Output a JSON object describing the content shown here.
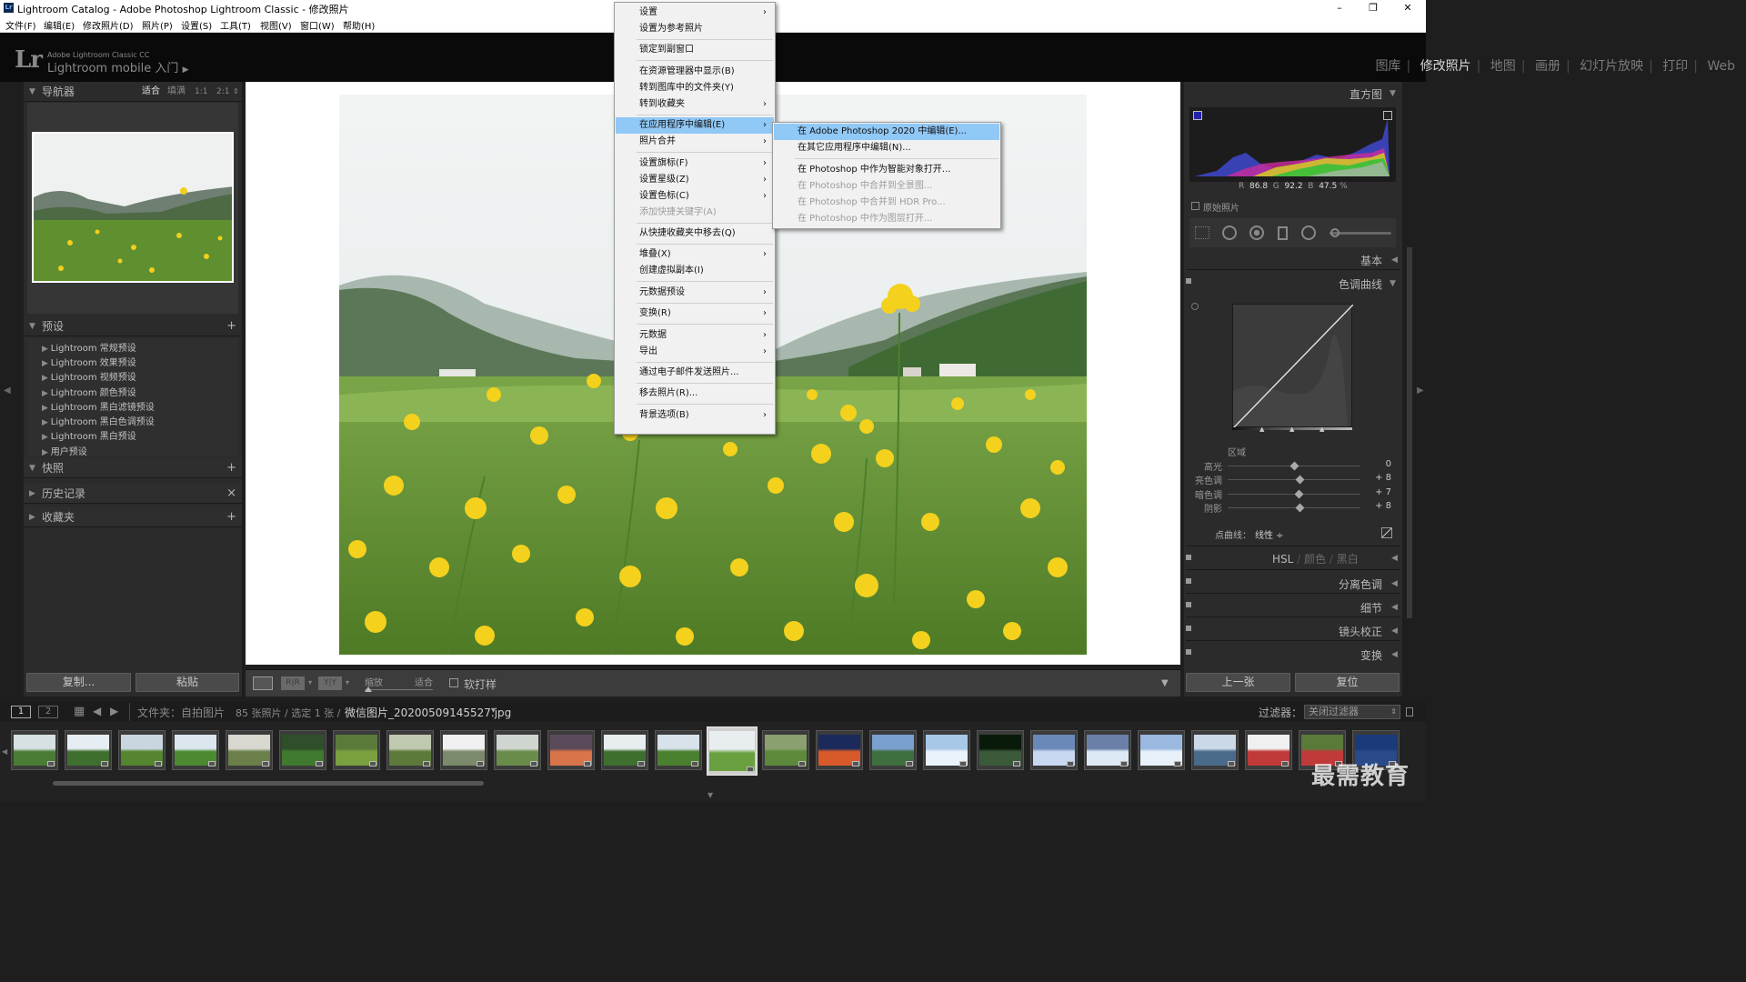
{
  "window": {
    "title": "Lightroom Catalog - Adobe Photoshop Lightroom Classic - 修改照片",
    "minimize": "–",
    "restore": "❐",
    "close": "✕"
  },
  "menubar": [
    "文件(F)",
    "编辑(E)",
    "修改照片(D)",
    "照片(P)",
    "设置(S)",
    "工具(T)",
    "视图(V)",
    "窗口(W)",
    "帮助(H)"
  ],
  "identity": {
    "logo": "Lr",
    "sub": "Adobe Lightroom Classic CC",
    "main": "Lightroom mobile 入门",
    "arrow": "▶"
  },
  "modules": [
    "图库",
    "修改照片",
    "地图",
    "画册",
    "幻灯片放映",
    "打印",
    "Web"
  ],
  "active_module": "修改照片",
  "navigator": {
    "title": "导航器",
    "opts": [
      "适合",
      "填满",
      "1:1",
      "2:1"
    ]
  },
  "presets": {
    "title": "预设",
    "add": "+",
    "items": [
      "Lightroom 常规预设",
      "Lightroom 效果预设",
      "Lightroom 视频预设",
      "Lightroom 颜色预设",
      "Lightroom 黑白滤镜预设",
      "Lightroom 黑白色调预设",
      "Lightroom 黑白预设",
      "用户预设"
    ]
  },
  "snapshots": {
    "title": "快照",
    "add": "+"
  },
  "history": {
    "title": "历史记录",
    "clear": "×"
  },
  "collections": {
    "title": "收藏夹",
    "add": "+"
  },
  "left_buttons": {
    "copy": "复制...",
    "paste": "粘贴"
  },
  "toolbar": {
    "zoom_label": "缩放",
    "zoom_value": "适合",
    "softproof": "软打样",
    "view_ry": "R|R",
    "view_yy": "Y|Y"
  },
  "histogram": {
    "title": "直方图",
    "r_label": "R",
    "r": "86.8",
    "g_label": "G",
    "g": "92.2",
    "b_label": "B",
    "b": "47.5",
    "unit": "%",
    "original": "原始照片"
  },
  "basic": "基本",
  "tone_curve": {
    "title": "色调曲线",
    "region": "区域",
    "sliders": [
      {
        "label": "高光",
        "value": "0",
        "pos": 0.5
      },
      {
        "label": "亮色调",
        "value": "+ 8",
        "pos": 0.54
      },
      {
        "label": "暗色调",
        "value": "+ 7",
        "pos": 0.535
      },
      {
        "label": "阴影",
        "value": "+ 8",
        "pos": 0.54
      }
    ],
    "point_curve_label": "点曲线：",
    "point_curve_value": "线性 ÷"
  },
  "hsl": {
    "hsl": "HSL",
    "color": "颜色",
    "bw": "黑白"
  },
  "sections": [
    "分离色调",
    "细节",
    "镜头校正",
    "变换"
  ],
  "right_buttons": {
    "prev": "上一张",
    "reset": "复位"
  },
  "filmbar": {
    "page1": "1",
    "page2": "2",
    "path": "文件夹：自拍图片",
    "count": "85 张照片 / 选定 1 张 /",
    "filename": "微信图片_20200509145527.jpg",
    "caret": "▾",
    "filter_label": "过滤器：",
    "filter_value": "关闭过滤器"
  },
  "context_menu": [
    {
      "label": "设置",
      "arrow": true
    },
    {
      "label": "设置为参考照片"
    },
    {
      "sep": true
    },
    {
      "label": "锁定到副窗口"
    },
    {
      "sep": true
    },
    {
      "label": "在资源管理器中显示(B)"
    },
    {
      "label": "转到图库中的文件夹(Y)"
    },
    {
      "label": "转到收藏夹",
      "arrow": true
    },
    {
      "sep": true
    },
    {
      "label": "在应用程序中编辑(E)",
      "arrow": true,
      "highlight": true
    },
    {
      "label": "照片合并",
      "arrow": true
    },
    {
      "sep": true
    },
    {
      "label": "设置旗标(F)",
      "arrow": true
    },
    {
      "label": "设置星级(Z)",
      "arrow": true
    },
    {
      "label": "设置色标(C)",
      "arrow": true
    },
    {
      "label": "添加快捷关键字(A)",
      "disabled": true
    },
    {
      "sep": true
    },
    {
      "label": "从快捷收藏夹中移去(Q)"
    },
    {
      "sep": true
    },
    {
      "label": "堆叠(X)",
      "arrow": true
    },
    {
      "label": "创建虚拟副本(I)"
    },
    {
      "sep": true
    },
    {
      "label": "元数据预设",
      "arrow": true
    },
    {
      "sep": true
    },
    {
      "label": "变换(R)",
      "arrow": true
    },
    {
      "sep": true
    },
    {
      "label": "元数据",
      "arrow": true
    },
    {
      "label": "导出",
      "arrow": true
    },
    {
      "sep": true
    },
    {
      "label": "通过电子邮件发送照片..."
    },
    {
      "sep": true
    },
    {
      "label": "移去照片(R)..."
    },
    {
      "sep": true
    },
    {
      "label": "背景选项(B)",
      "arrow": true
    }
  ],
  "submenu": [
    {
      "label": "在 Adobe Photoshop 2020 中编辑(E)...",
      "highlight": true
    },
    {
      "label": "在其它应用程序中编辑(N)..."
    },
    {
      "sep": true
    },
    {
      "label": "在 Photoshop 中作为智能对象打开..."
    },
    {
      "label": "在 Photoshop 中合并到全景图...",
      "disabled": true
    },
    {
      "label": "在 Photoshop 中合并到 HDR Pro...",
      "disabled": true
    },
    {
      "label": "在 Photoshop 中作为图层打开...",
      "disabled": true
    }
  ],
  "filmstrip_count": 26,
  "watermark": "最需教育",
  "colors": {
    "bg": "#1e1e1e",
    "panel": "#2b2b2b",
    "highlight": "#90c8f6",
    "rapeseed": "#f4d21e"
  }
}
